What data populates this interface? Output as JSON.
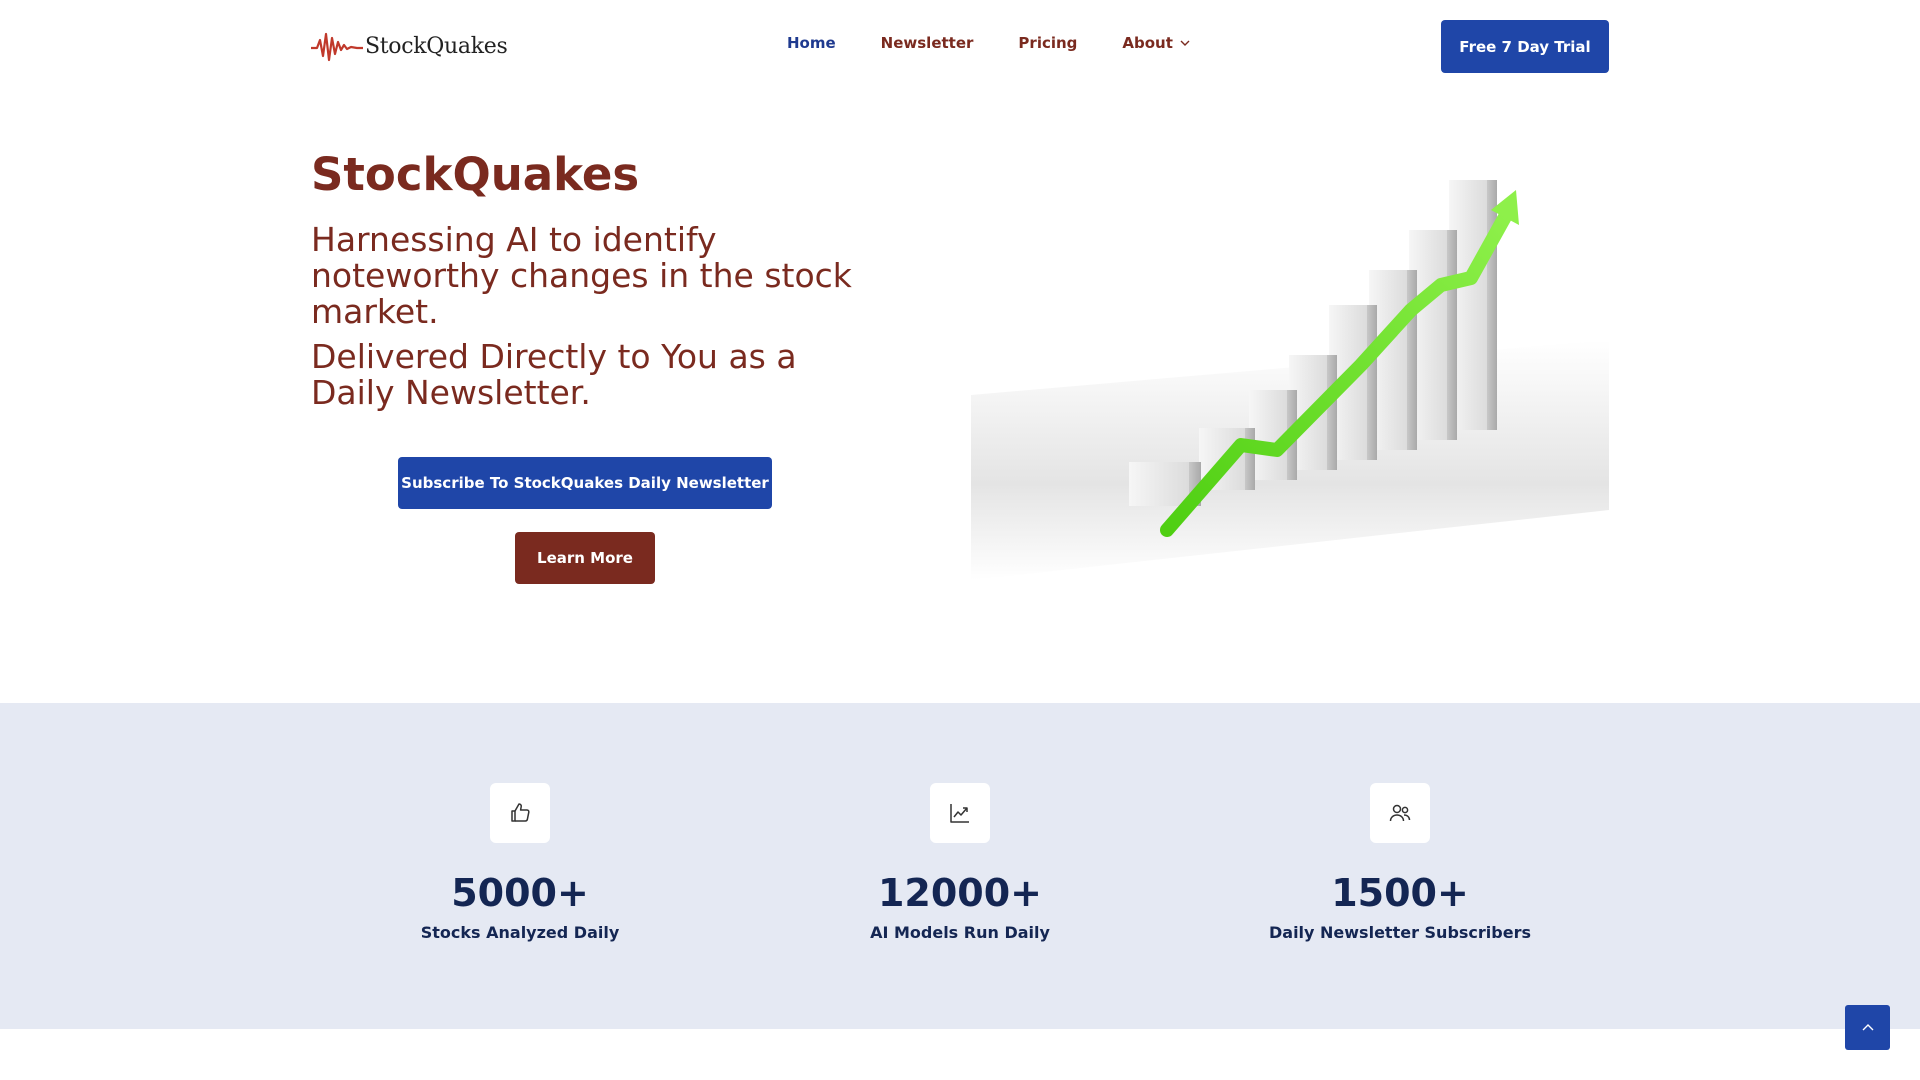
{
  "brand": {
    "name": "StockQuakes",
    "accent": "#7a2a1f",
    "primary": "#1f46a8"
  },
  "nav": {
    "items": [
      {
        "label": "Home",
        "active": true
      },
      {
        "label": "Newsletter",
        "active": false
      },
      {
        "label": "Pricing",
        "active": false
      },
      {
        "label": "About",
        "active": false,
        "has_dropdown": true
      }
    ],
    "cta_label": "Free 7 Day Trial"
  },
  "hero": {
    "title": "StockQuakes",
    "subtitle": "Harnessing AI to identify noteworthy changes in the stock market.",
    "subtitle2": "Delivered Directly to You as a Daily Newsletter.",
    "subscribe_label": "Subscribe To StockQuakes Daily Newsletter",
    "learn_more_label": "Learn More"
  },
  "stats": [
    {
      "icon": "thumbs-up-icon",
      "value": "5000+",
      "label": "Stocks Analyzed Daily"
    },
    {
      "icon": "chart-icon",
      "value": "12000+",
      "label": "AI Models Run Daily"
    },
    {
      "icon": "users-icon",
      "value": "1500+",
      "label": "Daily Newsletter Subscribers"
    }
  ],
  "scroll_top_icon": "chevron-up-icon"
}
